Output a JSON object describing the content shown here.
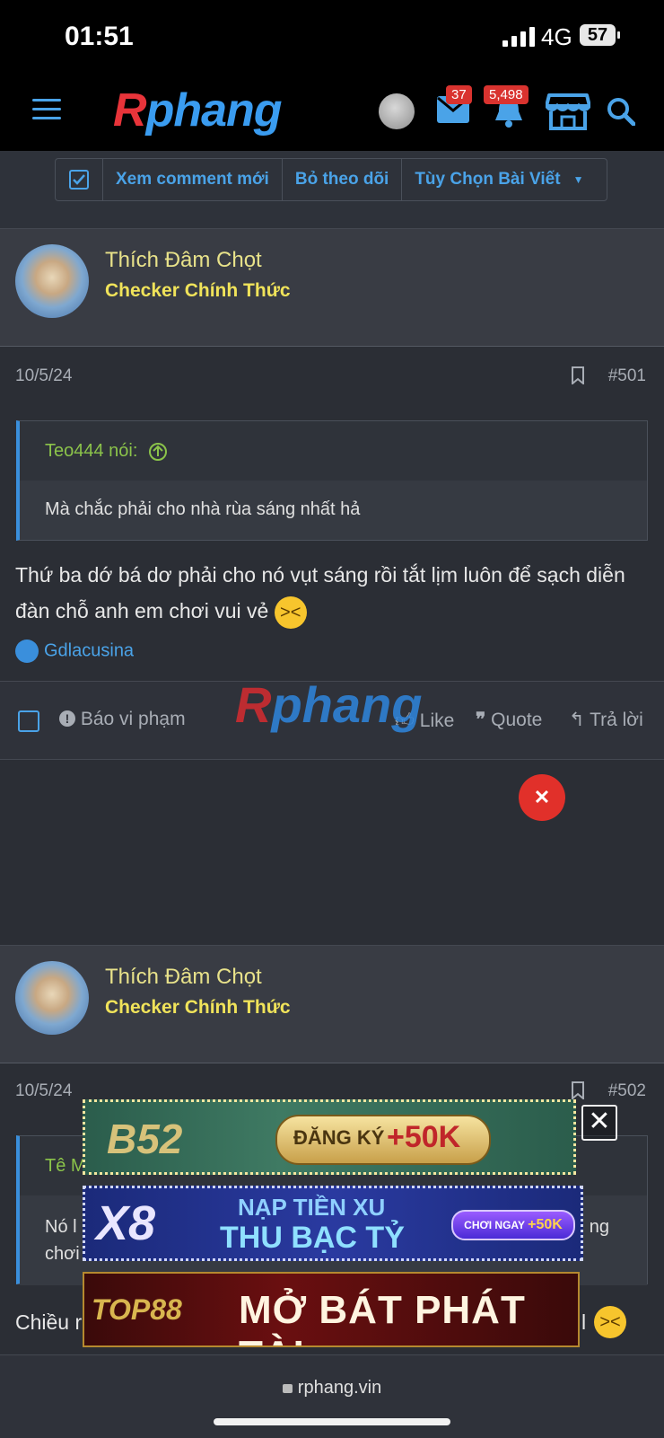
{
  "status_bar": {
    "time": "01:51",
    "network": "4G",
    "battery": "57"
  },
  "nav": {
    "logo_r": "R",
    "logo_rest": "phang",
    "messages_badge": "37",
    "alerts_badge": "5,498"
  },
  "thread_tools": {
    "new_comments": "Xem comment mới",
    "unwatch": "Bỏ theo dõi",
    "thread_options": "Tùy Chọn Bài Viết"
  },
  "posts": [
    {
      "username": "Thích Đâm Chọt",
      "user_title": "Checker Chính Thức",
      "date": "10/5/24",
      "number": "#501",
      "quote_author": "Teo444 nói:",
      "quote_text": "Mà chắc phải cho nhà rùa sáng nhất hả",
      "text": "Thứ ba dớ bá dơ phải cho nó vụt sáng rồi tắt lịm luôn để sạch diễn đàn chỗ anh em chơi vui vẻ",
      "reaction_user": "Gdlacusina",
      "actions": {
        "report": "Báo vi phạm",
        "like": "Like",
        "quote": "Quote",
        "reply": "Trả lời"
      }
    },
    {
      "username": "Thích Đâm Chọt",
      "user_title": "Checker Chính Thức",
      "date": "10/5/24",
      "number": "#502",
      "quote_author_partial": "Tê M",
      "quote_text_left1": "Nó l",
      "quote_text_left2": "chơi",
      "quote_text_right": "ng",
      "text_left": "Chiều r",
      "text_right": "l"
    }
  ],
  "ads": [
    {
      "brand": "B52",
      "text": "ĐĂNG KÝ",
      "bonus": "+50K"
    },
    {
      "brand": "X8",
      "line1": "NẠP TIỀN XU",
      "line2": "THU BẠC TỶ",
      "cta": "CHƠI NGAY",
      "bonus": "+50K"
    },
    {
      "brand": "TOP88",
      "text": "MỞ BÁT PHÁT TÀI"
    }
  ],
  "browser": {
    "url": "rphang.vin"
  },
  "colors": {
    "accent": "#4aa3e8",
    "username": "#e8e28a",
    "user_title": "#f0e35a",
    "quote_author": "#8bc34a",
    "badge": "#d9332f"
  }
}
